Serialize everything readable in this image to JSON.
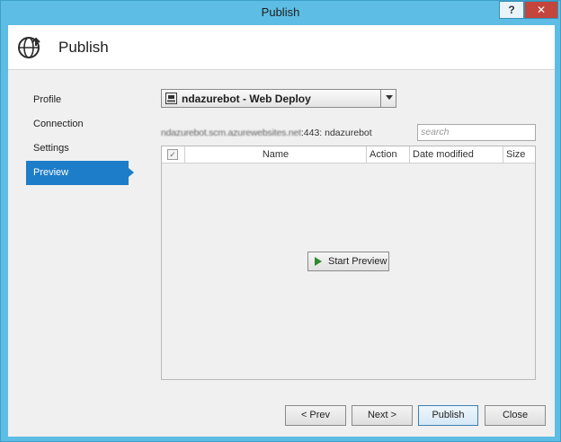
{
  "window": {
    "title": "Publish"
  },
  "titlebar": {
    "help_label": "?",
    "close_label": "✕"
  },
  "header": {
    "title": "Publish",
    "icon": "globe-publish-icon"
  },
  "nav": {
    "items": [
      {
        "label": "Profile",
        "active": false
      },
      {
        "label": "Connection",
        "active": false
      },
      {
        "label": "Settings",
        "active": false
      },
      {
        "label": "Preview",
        "active": true
      }
    ]
  },
  "profile": {
    "selected": "ndazurebot - Web Deploy",
    "icon": "web-deploy-icon"
  },
  "server": {
    "host_obscured": "ndazurebot.scm.azurewebsites.net",
    "suffix": ":443: ndazurebot"
  },
  "search": {
    "placeholder": "search",
    "value": ""
  },
  "grid": {
    "columns": [
      "Name",
      "Action",
      "Date modified",
      "Size"
    ],
    "select_all_checked": true,
    "rows": []
  },
  "start_preview": {
    "label": "Start Preview"
  },
  "buttons": {
    "prev": "< Prev",
    "next": "Next >",
    "publish": "Publish",
    "close": "Close"
  },
  "colors": {
    "frame": "#5ebde4",
    "accent": "#1e7dc8",
    "close_red": "#c4453c",
    "play_green": "#2e8b2e"
  }
}
